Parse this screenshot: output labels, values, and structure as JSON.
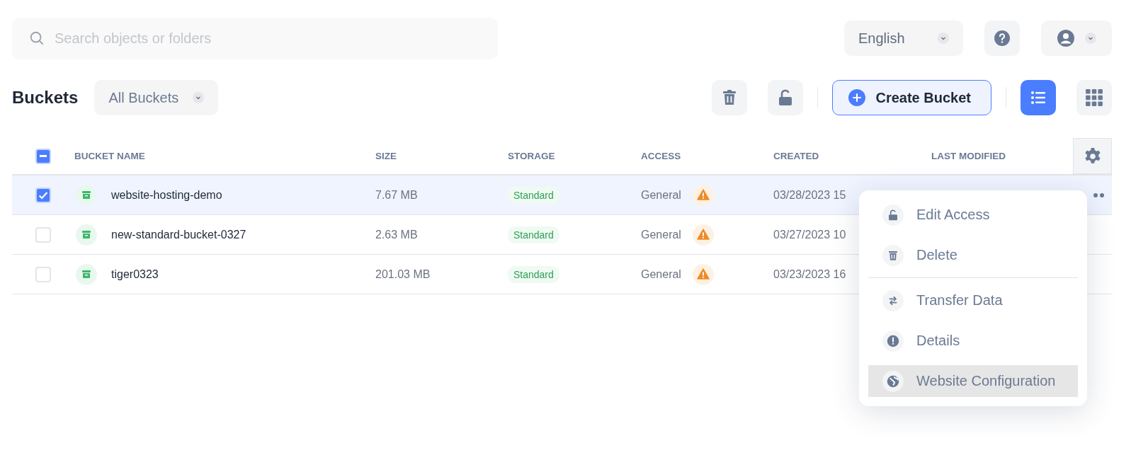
{
  "search": {
    "placeholder": "Search objects or folders"
  },
  "language": {
    "value": "English"
  },
  "title": "Buckets",
  "filter": {
    "value": "All Buckets"
  },
  "create_button": "Create Bucket",
  "views": [
    {
      "selected": true
    },
    {
      "selected": false
    }
  ],
  "table": {
    "select_all": {
      "indeterminate": true
    },
    "columns": [
      "BUCKET NAME",
      "SIZE",
      "STORAGE",
      "ACCESS",
      "CREATED",
      "LAST MODIFIED"
    ],
    "rows": [
      {
        "selected": true,
        "name": "website-hosting-demo",
        "size": "7.67 MB",
        "storage": "Standard",
        "access": "General",
        "warning": true,
        "created": "03/28/2023 15",
        "menu_open": true
      },
      {
        "selected": false,
        "name": "new-standard-bucket-0327",
        "size": "2.63 MB",
        "storage": "Standard",
        "access": "General",
        "warning": true,
        "created": "03/27/2023 10",
        "menu_open": false
      },
      {
        "selected": false,
        "name": "tiger0323",
        "size": "201.03 MB",
        "storage": "Standard",
        "access": "General",
        "warning": true,
        "created": "03/23/2023 16",
        "menu_open": false
      }
    ]
  },
  "menu": {
    "groups": [
      [
        {
          "label": "Edit Access",
          "highlighted": false
        },
        {
          "label": "Delete",
          "highlighted": false
        }
      ],
      [
        {
          "label": "Transfer Data",
          "highlighted": false
        },
        {
          "label": "Details",
          "highlighted": false
        },
        {
          "label": "Website Configuration",
          "highlighted": true
        }
      ]
    ]
  }
}
